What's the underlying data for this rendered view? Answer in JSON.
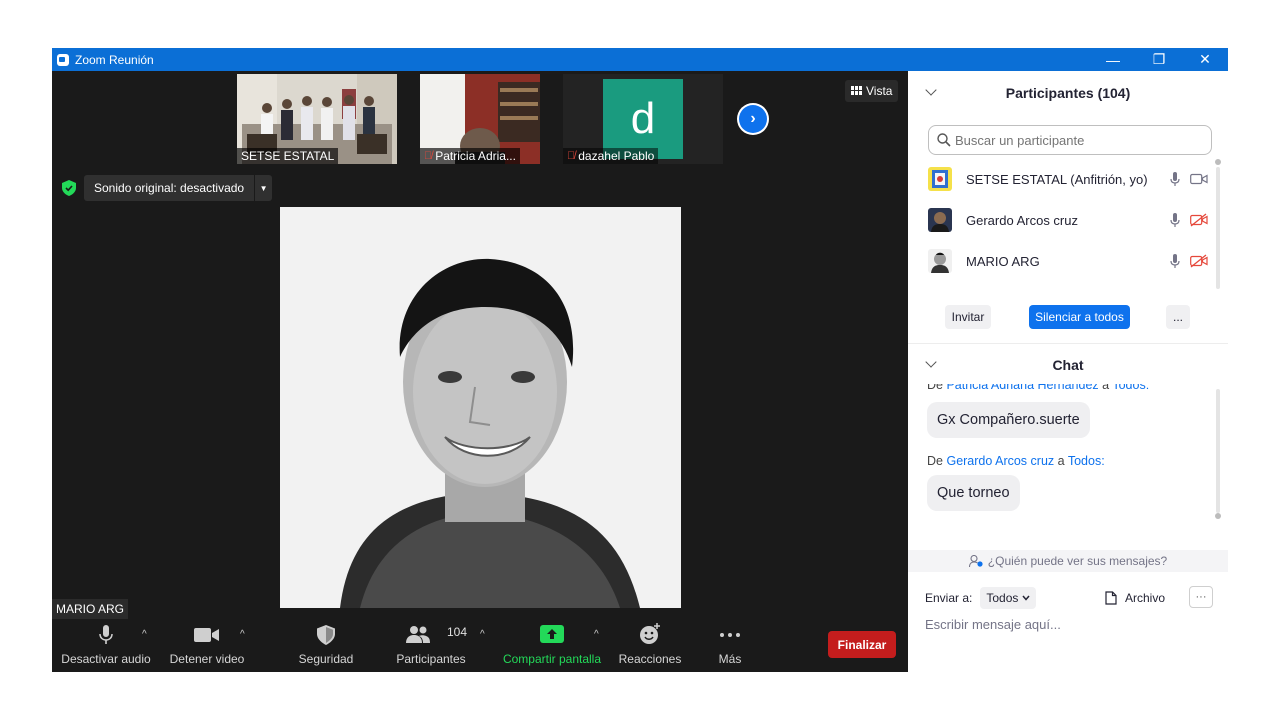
{
  "window": {
    "title": "Zoom Reunión",
    "controls": {
      "minimize": "—",
      "restore": "❐",
      "close": "✕"
    }
  },
  "thumbnails": [
    {
      "name": "SETSE ESTATAL",
      "muted": false
    },
    {
      "name": "Patricia Adria...",
      "muted": true
    },
    {
      "name": "dazahel Pablo",
      "muted": true,
      "avatar_letter": "d",
      "avatar_color": "#1a9b7f"
    }
  ],
  "view_button": {
    "label": "Vista"
  },
  "sound": {
    "label": "Sonido original: desactivado"
  },
  "speaker": {
    "name": "MARIO ARG"
  },
  "toolbar": {
    "audio_label": "Desactivar audio",
    "video_label": "Detener video",
    "security_label": "Seguridad",
    "participants_label": "Participantes",
    "participants_count": "104",
    "share_label": "Compartir pantalla",
    "reactions_label": "Reacciones",
    "more_label": "Más",
    "end_label": "Finalizar"
  },
  "participants_panel": {
    "title": "Participantes (104)",
    "search_placeholder": "Buscar un participante",
    "items": [
      {
        "name": "SETSE ESTATAL (Anfitrión, yo)",
        "video_on": true
      },
      {
        "name": "Gerardo Arcos cruz",
        "video_on": false
      },
      {
        "name": "MARIO ARG",
        "video_on": false
      }
    ],
    "invite_label": "Invitar",
    "mute_all_label": "Silenciar a todos",
    "more_label": "..."
  },
  "chat": {
    "title": "Chat",
    "messages": [
      {
        "prefix": "De",
        "from": "Patricia Adriana Hernández",
        "connector": "a",
        "to": "Todos:",
        "text": "Gx Compañero.suerte"
      },
      {
        "prefix": "De",
        "from": "Gerardo Arcos cruz",
        "connector": "a",
        "to": "Todos:",
        "text": "Que torneo"
      }
    ],
    "who_can_see": "¿Quién puede ver sus mensajes?",
    "send_to_label": "Enviar a:",
    "send_to_value": "Todos",
    "file_label": "Archivo",
    "more_label": "···",
    "input_placeholder": "Escribir mensaje aquí..."
  },
  "colors": {
    "titlebar": "#0b6fd6",
    "accent_blue": "#0e72ed",
    "share_green": "#23d959",
    "end_red": "#c41d1d",
    "mute_red": "#e5483b"
  }
}
